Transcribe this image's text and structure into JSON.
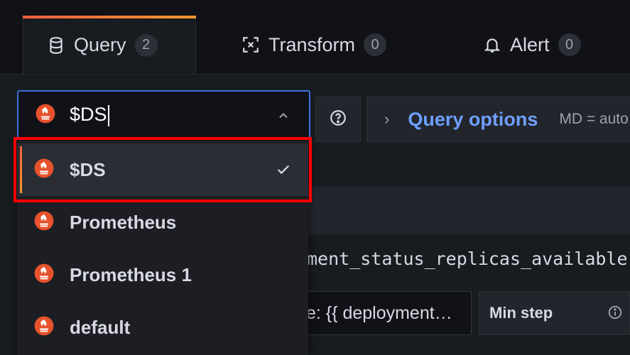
{
  "tabs": [
    {
      "label": "Query",
      "count": "2"
    },
    {
      "label": "Transform",
      "count": "0"
    },
    {
      "label": "Alert",
      "count": "0"
    }
  ],
  "datasource_picker": {
    "value": "$DS",
    "icon": "prometheus-icon"
  },
  "query_options": {
    "label": "Query options",
    "meta": "MD = auto"
  },
  "query_text": "ment_status_replicas_available",
  "legend_value": "e: {{ deployment…",
  "min_step": {
    "label": "Min step"
  },
  "datasource_menu": {
    "items": [
      {
        "name": "$DS",
        "selected": true
      },
      {
        "name": "Prometheus",
        "selected": false
      },
      {
        "name": "Prometheus 1",
        "selected": false
      },
      {
        "name": "default",
        "selected": false
      }
    ]
  },
  "colors": {
    "accent": "#3d71d9",
    "link": "#6e9fff",
    "prometheus": "#e6522c",
    "highlight": "#ff0000"
  }
}
